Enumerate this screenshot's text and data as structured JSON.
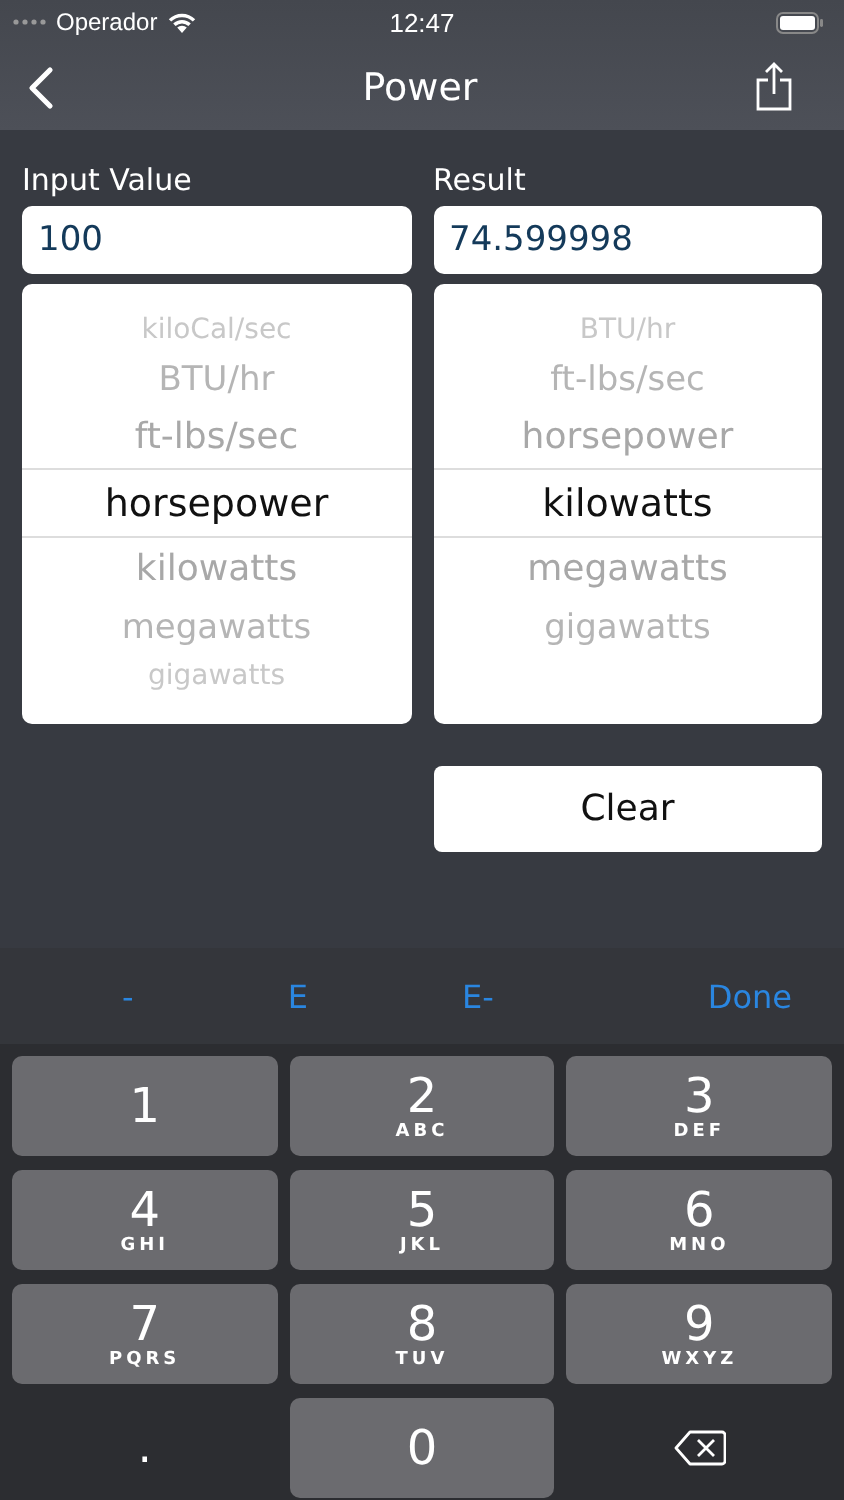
{
  "status_bar": {
    "carrier": "Operador",
    "time": "12:47"
  },
  "nav_bar": {
    "title": "Power"
  },
  "input": {
    "label": "Input Value",
    "value": "100"
  },
  "result": {
    "label": "Result",
    "value": "74.599998"
  },
  "input_picker": [
    {
      "label": "kiloCal/sec",
      "selected": false
    },
    {
      "label": "BTU/hr",
      "selected": false
    },
    {
      "label": "ft-lbs/sec",
      "selected": false
    },
    {
      "label": "horsepower",
      "selected": true
    },
    {
      "label": "kilowatts",
      "selected": false
    },
    {
      "label": "megawatts",
      "selected": false
    },
    {
      "label": "gigawatts",
      "selected": false
    }
  ],
  "result_picker": [
    {
      "label": "BTU/hr",
      "selected": false
    },
    {
      "label": "ft-lbs/sec",
      "selected": false
    },
    {
      "label": "horsepower",
      "selected": false
    },
    {
      "label": "kilowatts",
      "selected": true
    },
    {
      "label": "megawatts",
      "selected": false
    },
    {
      "label": "gigawatts",
      "selected": false
    }
  ],
  "clear_button": "Clear",
  "keyboard_toolbar": [
    "-",
    "E",
    "E-",
    "Done"
  ],
  "keys": [
    {
      "kind": "key",
      "digit": "1"
    },
    {
      "kind": "key",
      "digit": "2",
      "letters": "ABC"
    },
    {
      "kind": "key",
      "digit": "3",
      "letters": "DEF"
    },
    {
      "kind": "key",
      "digit": "4",
      "letters": "GHI"
    },
    {
      "kind": "key",
      "digit": "5",
      "letters": "JKL"
    },
    {
      "kind": "key",
      "digit": "6",
      "letters": "MNO"
    },
    {
      "kind": "key",
      "digit": "7",
      "letters": "PQRS"
    },
    {
      "kind": "key",
      "digit": "8",
      "letters": "TUV"
    },
    {
      "kind": "key",
      "digit": "9",
      "letters": "WXYZ"
    },
    {
      "kind": "plain",
      "digit": "."
    },
    {
      "kind": "key",
      "digit": "0"
    },
    {
      "kind": "backspace"
    }
  ]
}
